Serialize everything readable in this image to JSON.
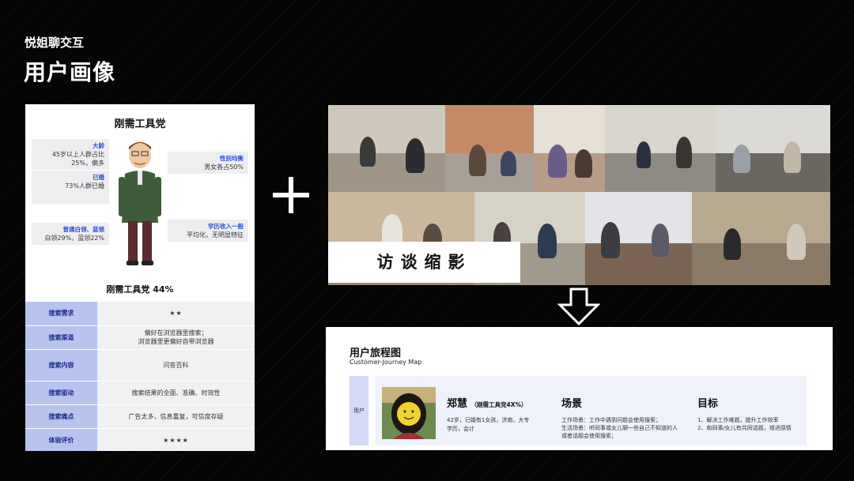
{
  "header": {
    "brand": "悦姐聊交互",
    "title": "用户画像"
  },
  "persona": {
    "name": "刚需工具党",
    "tags": {
      "age": {
        "key": "大龄",
        "value": "45岁以上人群占比25%，偏多"
      },
      "married": {
        "key": "已婚",
        "value": "73%人群已婚"
      },
      "job": {
        "key": "普通白领、蓝领",
        "value": "白领29%，蓝领22%"
      },
      "gender": {
        "key": "性别均衡",
        "value": "男女各占50%"
      },
      "education": {
        "key": "学历收入一般",
        "value": "平均化，无明显特征"
      }
    },
    "ratio": "刚需工具党 44%",
    "table": [
      {
        "key": "搜索需求",
        "value": "★★",
        "stars": 2
      },
      {
        "key": "搜索渠道",
        "value_line1": "偏好在浏览器里搜索；",
        "value_line2": "浏览器里更偏好自带浏览器"
      },
      {
        "key": "搜索内容",
        "value": "问答百科"
      },
      {
        "key": "搜索驱动",
        "value": "搜索结果的全面、准确、时效性"
      },
      {
        "key": "搜索痛点",
        "value": "广告太多，信息重复，可信度存疑"
      },
      {
        "key": "体验评价",
        "value": "★★★★",
        "stars": 4
      }
    ]
  },
  "collage": {
    "label": "访谈缩影"
  },
  "journey": {
    "title": "用户旅程图",
    "subtitle": "Customer-Journey Map",
    "row_label": "用户",
    "user": {
      "name": "郑慧",
      "name_note": "（刚需工具党4X%）",
      "desc": "42岁，已婚有1女孩，济南，大专学历，会计"
    },
    "scene": {
      "heading": "场景",
      "line1": "工作场景：工作中遇到问题会使用搜索；",
      "line2": "生活场景：听同事或女儿聊一些自己不知道的人或者话题会使用搜索；"
    },
    "goal": {
      "heading": "目标",
      "line1": "1、解决工作难题，提升工作效率",
      "line2": "2、和同事/女儿有共同话题，增进感情"
    }
  },
  "colors": {
    "background": "#050505",
    "accent_blue": "#2b4fd8",
    "table_key_bg": "#b8c3ee",
    "journey_panel": "#eff2fb"
  },
  "icons": [
    "plus-icon",
    "down-arrow-icon",
    "persona-illustration",
    "avatar-photo"
  ]
}
